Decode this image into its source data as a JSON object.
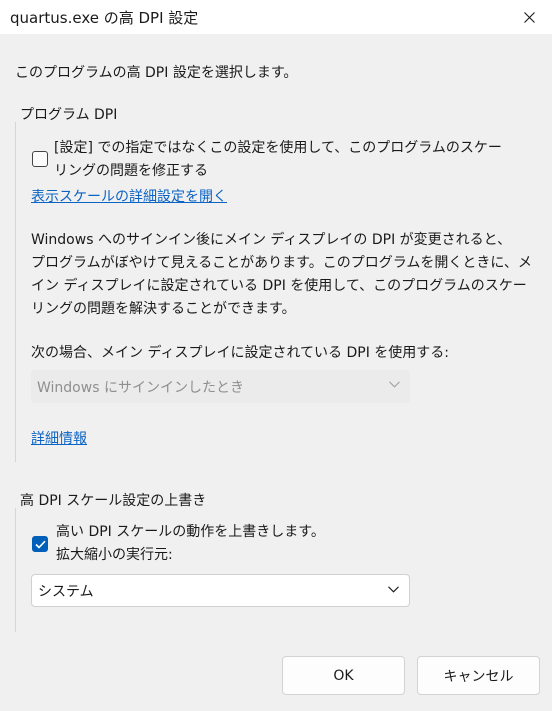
{
  "window": {
    "title": "quartus.exe の高 DPI 設定"
  },
  "intro_text": "このプログラムの高 DPI 設定を選択します。",
  "program_dpi": {
    "group_title": "プログラム DPI",
    "checkbox_checked": false,
    "checkbox_label_line1": "[設定] での指定ではなくこの設定を使用して、このプログラムのスケー",
    "checkbox_label_line2": "リングの問題を修正する",
    "link_text": "表示スケールの詳細設定を開く",
    "description_lines": [
      "Windows へのサインイン後にメイン ディスプレイの DPI が変更されると、",
      "プログラムがぼやけて見えることがあります。このプログラムを開くときに、メ",
      "イン ディスプレイに設定されている DPI を使用して、このプログラムのスケー",
      "リングの問題を解決することができます。"
    ],
    "select_label": "次の場合、メイン ディスプレイに設定されている DPI を使用する:",
    "select_value": "Windows にサインインしたとき",
    "details_link": "詳細情報"
  },
  "override": {
    "group_title": "高 DPI スケール設定の上書き",
    "checkbox_checked": true,
    "checkbox_label": "高い DPI スケールの動作を上書きします。",
    "scaling_label": "拡大縮小の実行元:",
    "select_value": "システム"
  },
  "footer": {
    "ok_label": "OK",
    "cancel_label": "キャンセル"
  },
  "colors": {
    "accent": "#005fb8",
    "link": "#0b63c4"
  }
}
